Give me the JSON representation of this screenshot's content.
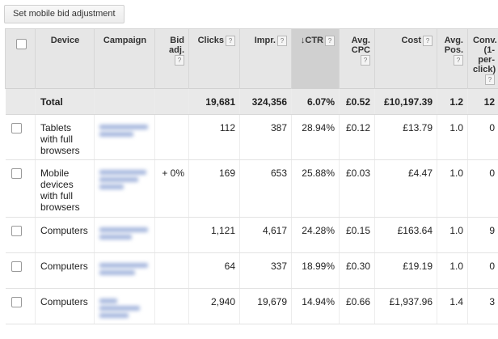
{
  "toolbar": {
    "set_bid_label": "Set mobile bid adjustment"
  },
  "columns": {
    "device": "Device",
    "campaign": "Campaign",
    "bid_adj": "Bid adj.",
    "clicks": "Clicks",
    "impr": "Impr.",
    "ctr": "CTR",
    "avg_cpc": "Avg. CPC",
    "cost": "Cost",
    "avg_pos": "Avg. Pos.",
    "conv": "Conv. (1-per-click)",
    "help_glyph": "?",
    "sort_arrow": "↓"
  },
  "total": {
    "label": "Total",
    "clicks": "19,681",
    "impr": "324,356",
    "ctr": "6.07%",
    "avg_cpc": "£0.52",
    "cost": "£10,197.39",
    "avg_pos": "1.2",
    "conv": "12"
  },
  "rows": [
    {
      "device": "Tablets with full browsers",
      "bid_adj": "",
      "clicks": "112",
      "impr": "387",
      "ctr": "28.94%",
      "avg_cpc": "£0.12",
      "cost": "£13.79",
      "avg_pos": "1.0",
      "conv": "0"
    },
    {
      "device": "Mobile devices with full browsers",
      "bid_adj": "+ 0%",
      "clicks": "169",
      "impr": "653",
      "ctr": "25.88%",
      "avg_cpc": "£0.03",
      "cost": "£4.47",
      "avg_pos": "1.0",
      "conv": "0"
    },
    {
      "device": "Computers",
      "bid_adj": "",
      "clicks": "1,121",
      "impr": "4,617",
      "ctr": "24.28%",
      "avg_cpc": "£0.15",
      "cost": "£163.64",
      "avg_pos": "1.0",
      "conv": "9"
    },
    {
      "device": "Computers",
      "bid_adj": "",
      "clicks": "64",
      "impr": "337",
      "ctr": "18.99%",
      "avg_cpc": "£0.30",
      "cost": "£19.19",
      "avg_pos": "1.0",
      "conv": "0"
    },
    {
      "device": "Computers",
      "bid_adj": "",
      "clicks": "2,940",
      "impr": "19,679",
      "ctr": "14.94%",
      "avg_cpc": "£0.66",
      "cost": "£1,937.96",
      "avg_pos": "1.4",
      "conv": "3"
    }
  ]
}
